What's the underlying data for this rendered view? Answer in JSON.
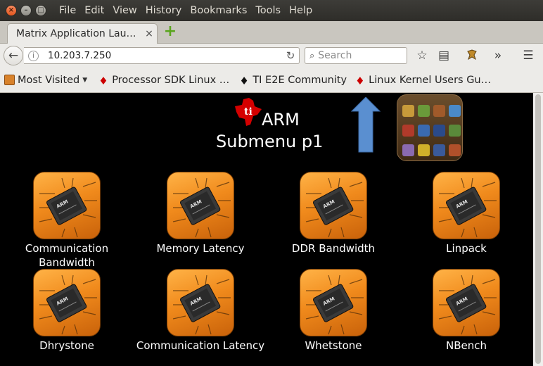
{
  "menubar": {
    "items": [
      "File",
      "Edit",
      "View",
      "History",
      "Bookmarks",
      "Tools",
      "Help"
    ]
  },
  "tab": {
    "title": "Matrix Application Lau…",
    "close": "×",
    "new_tab": "+"
  },
  "navbar": {
    "url": "10.203.7.250",
    "search_placeholder": "Search"
  },
  "bookmarks": [
    {
      "label": "Most Visited",
      "icon": "folder-icon"
    },
    {
      "label": "Processor SDK Linux …",
      "icon": "ti-logo-icon"
    },
    {
      "label": "TI E2E Community",
      "icon": "ti-logo-icon"
    },
    {
      "label": "Linux Kernel Users Gu…",
      "icon": "ti-logo-icon"
    }
  ],
  "page": {
    "title_line1": "ARM",
    "title_line2": "Submenu p1",
    "apps": [
      {
        "label": "Communication Bandwidth"
      },
      {
        "label": "Memory Latency"
      },
      {
        "label": "DDR Bandwidth"
      },
      {
        "label": "Linpack"
      },
      {
        "label": "Dhrystone"
      },
      {
        "label": "Communication Latency"
      },
      {
        "label": "Whetstone"
      },
      {
        "label": "NBench"
      }
    ]
  },
  "colors": {
    "accent_orange": "#f08a1c",
    "ti_red": "#cc0000",
    "arrow_blue": "#5a8fd0"
  }
}
